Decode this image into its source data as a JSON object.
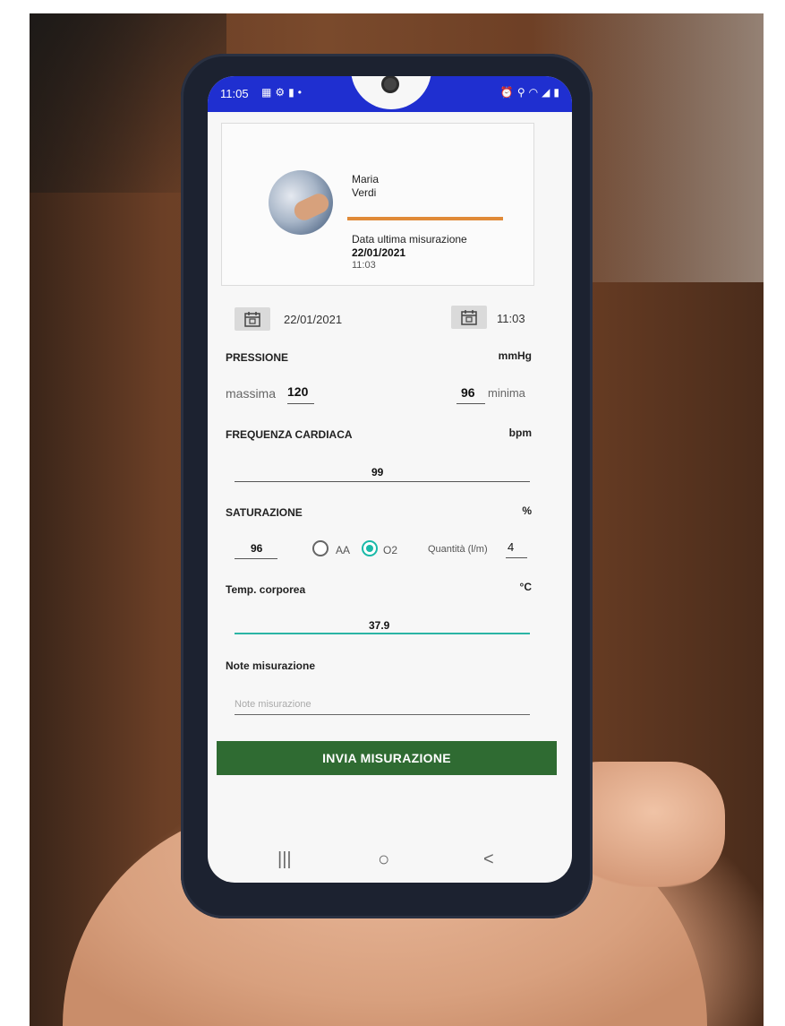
{
  "status_bar": {
    "time": "11:05",
    "left_icons": [
      "calendar-icon",
      "settings-icon",
      "app-icon",
      "dot-icon"
    ],
    "right_icons": [
      "alarm-icon",
      "location-icon",
      "wifi-icon",
      "signal-icon",
      "battery-icon"
    ]
  },
  "patient": {
    "first_name": "Maria",
    "last_name": "Verdi",
    "last_label": "Data ultima misurazione",
    "last_date": "22/01/2021",
    "last_time": "11:03",
    "accent_color": "#e08a38"
  },
  "measurement": {
    "date": "22/01/2021",
    "time": "11:03"
  },
  "pressure": {
    "label": "PRESSIONE",
    "unit": "mmHg",
    "max_label": "massima",
    "max_value": "120",
    "min_label": "minima",
    "min_value": "96"
  },
  "heart_rate": {
    "label": "FREQUENZA CARDIACA",
    "unit": "bpm",
    "value": "99"
  },
  "saturation": {
    "label": "SATURAZIONE",
    "unit": "%",
    "value": "96",
    "option_aa": "AA",
    "option_o2": "O2",
    "selected": "O2",
    "quantity_label": "Quantità (l/m)",
    "quantity_value": "4",
    "accent_color": "#19b9a8"
  },
  "temperature": {
    "label": "Temp. corporea",
    "unit": "°C",
    "value": "37.9"
  },
  "notes": {
    "label": "Note misurazione",
    "placeholder": "Note misurazione"
  },
  "submit": {
    "label": "INVIA MISURAZIONE",
    "color": "#2f6b32"
  },
  "nav": {
    "recents": "|||",
    "home": "○",
    "back": "<"
  },
  "colors": {
    "status_bar": "#1f2fd0"
  }
}
